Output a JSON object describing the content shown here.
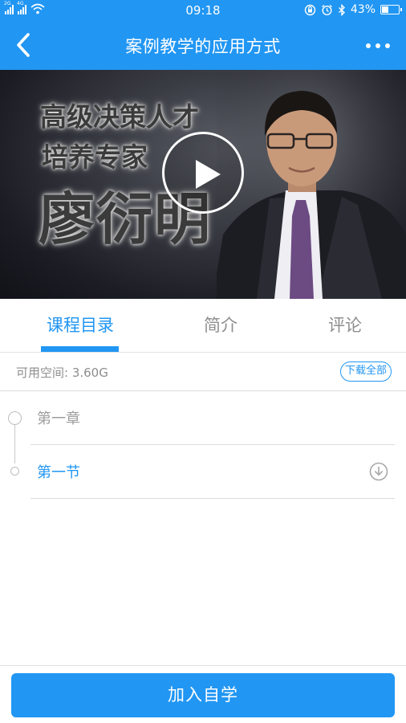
{
  "status_bar": {
    "network_a": "2G",
    "network_b": "4G",
    "time": "09:18",
    "battery_percent": "43%",
    "battery_level": 0.43
  },
  "app_bar": {
    "title": "案例教学的应用方式"
  },
  "video": {
    "line1": "高级决策人才",
    "line2": "培养专家",
    "name": "廖衍明"
  },
  "tabs": [
    {
      "label": "课程目录",
      "active": true
    },
    {
      "label": "简介",
      "active": false
    },
    {
      "label": "评论",
      "active": false
    }
  ],
  "storage": {
    "available": "可用空间: 3.60G",
    "download_all": "下载全部"
  },
  "chapters": {
    "chapter_label": "第一章",
    "section_label": "第一节"
  },
  "bottom": {
    "join_label": "加入自学"
  },
  "colors": {
    "primary": "#2196F3",
    "muted_text": "#8e8e8e"
  }
}
